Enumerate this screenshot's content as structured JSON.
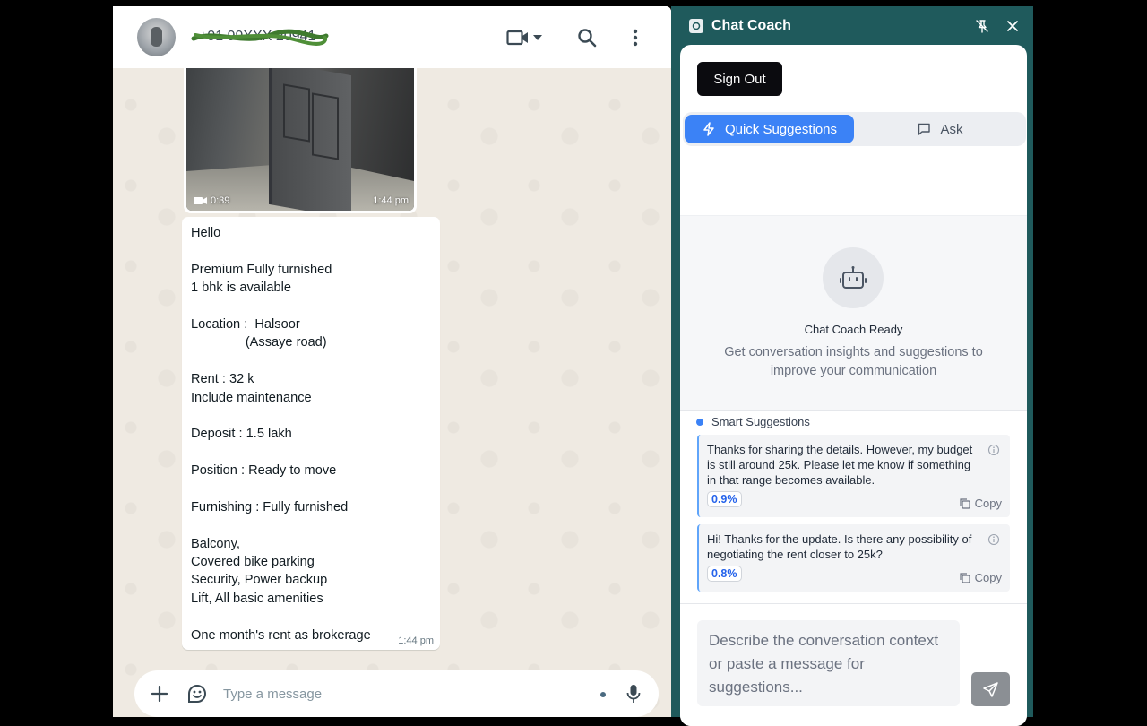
{
  "chat": {
    "contact_name": "+91 99XXX 20941",
    "media": {
      "duration": "0:39",
      "time": "1:44 pm"
    },
    "message_lines": [
      "Hello",
      "",
      "Premium Fully furnished",
      "1 bhk is available",
      "",
      "Location :  Halsoor",
      "               (Assaye road)",
      "",
      "Rent : 32 k",
      "Include maintenance",
      "",
      "Deposit : 1.5 lakh",
      "",
      "Position : Ready to move",
      "",
      "Furnishing : Fully furnished",
      "",
      "Balcony,",
      "Covered bike parking",
      "Security, Power backup",
      "Lift, All basic amenities",
      "",
      "One month's rent as brokerage"
    ],
    "message_time": "1:44 pm",
    "composer_placeholder": "Type a message"
  },
  "coach": {
    "title": "Chat Coach",
    "sign_out": "Sign Out",
    "tabs": {
      "quick": "Quick Suggestions",
      "ask": "Ask"
    },
    "ready_title": "Chat Coach Ready",
    "ready_desc": "Get conversation insights and suggestions to improve your communication",
    "suggestions_heading": "Smart Suggestions",
    "suggestions": [
      {
        "text": "Thanks for sharing the details. However, my budget is still around 25k. Please let me know if something in that range becomes available.",
        "score": "0.9%",
        "copy": "Copy"
      },
      {
        "text": "Hi! Thanks for the update. Is there any possibility of negotiating the rent closer to 25k?",
        "score": "0.8%",
        "copy": "Copy"
      }
    ],
    "ask_placeholder": "Describe the conversation context or paste a message for suggestions..."
  },
  "colors": {
    "accent": "#3b82f6",
    "panel_bg": "#1f5a5c",
    "chat_bg": "#efeae2"
  },
  "icons": [
    "video-call-icon",
    "chevron-down-icon",
    "search-icon",
    "menu-kebab-icon",
    "plus-icon",
    "sticker-icon",
    "mic-icon",
    "pin-off-icon",
    "close-icon",
    "lightning-icon",
    "chat-bubble-icon",
    "robot-icon",
    "info-icon",
    "copy-icon",
    "send-icon"
  ]
}
